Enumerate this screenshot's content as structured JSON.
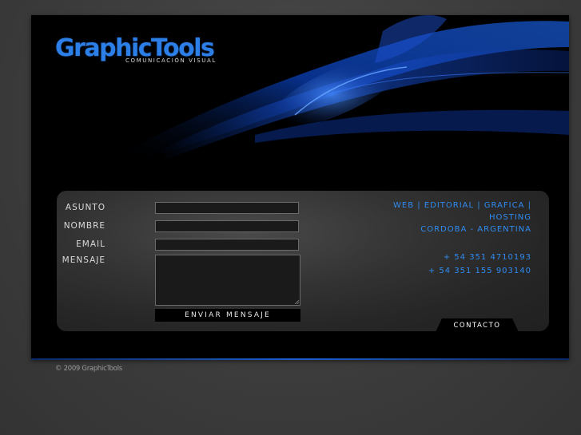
{
  "header": {
    "logo_text": "GraphicTools",
    "logo_subtitle": "COMUNICACIÓN VISUAL"
  },
  "form": {
    "subject_label": "ASUNTO",
    "name_label": "NOMBRE",
    "email_label": "EMAIL",
    "message_label": "MENSAJE",
    "subject_value": "",
    "name_value": "",
    "email_value": "",
    "message_value": "",
    "submit_label": "ENVIAR MENSAJE"
  },
  "info": {
    "services_line1": "WEB | EDITORIAL | GRAFICA |",
    "services_line2": "HOSTING",
    "location": "CORDOBA - ARGENTINA",
    "phone1": "+ 54 351 4710193",
    "phone2": "+ 54 351 155 903140"
  },
  "tab": {
    "label": "CONTACTO"
  },
  "footer": {
    "copyright": "© 2009 GraphicTools"
  },
  "colors": {
    "accent": "#2f8bf2",
    "logo": "#2d7fe8",
    "frame": "#000000",
    "page_background": "#3a3a3a"
  }
}
